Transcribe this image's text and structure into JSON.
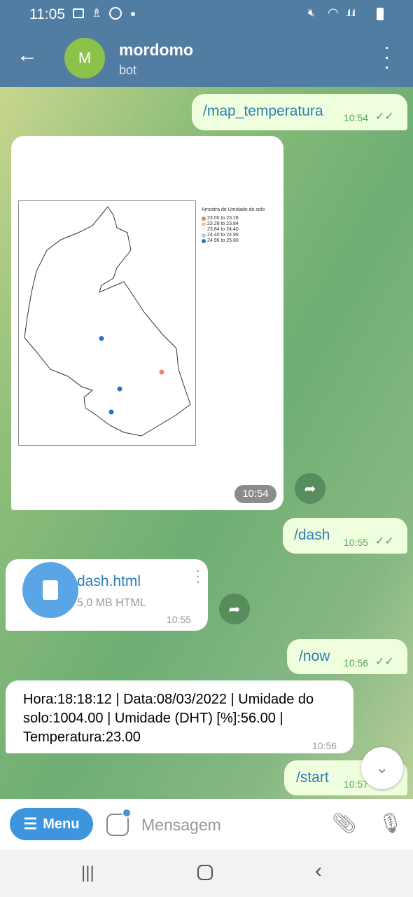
{
  "status_bar": {
    "time": "11:05"
  },
  "header": {
    "avatar_letter": "M",
    "title": "mordomo",
    "subtitle": "bot",
    "avatar_color": "#8bc34a"
  },
  "messages": [
    {
      "type": "out",
      "text": "/map_temperatura",
      "time": "10:54"
    },
    {
      "type": "photo",
      "time": "10:54",
      "map": {
        "legend_title": "Amostra de Umidade do solo",
        "legend": [
          {
            "label": "23.00 to 23.28",
            "color": "#e8826a"
          },
          {
            "label": "23.28 to 23.84",
            "color": "#f5c5b3"
          },
          {
            "label": "23.84 to 24.40",
            "color": "#f5f5f5"
          },
          {
            "label": "24.40 to 24.96",
            "color": "#a7cfe6"
          },
          {
            "label": "24.96 to 25.80",
            "color": "#2c72b2"
          }
        ]
      }
    },
    {
      "type": "out",
      "text": "/dash",
      "time": "10:55"
    },
    {
      "type": "file",
      "name": "dash.html",
      "size": "5,0 MB HTML",
      "time": "10:55"
    },
    {
      "type": "out",
      "text": "/now",
      "time": "10:56"
    },
    {
      "type": "in",
      "text": "Hora:18:18:12 | Data:08/03/2022 | Umidade do solo:1004.00 | Umidade (DHT) [%]:56.00 | Temperatura:23.00",
      "time": "10:56"
    },
    {
      "type": "out",
      "text": "/start",
      "time": "10:57"
    }
  ],
  "input": {
    "menu_label": "Menu",
    "placeholder": "Mensagem"
  }
}
